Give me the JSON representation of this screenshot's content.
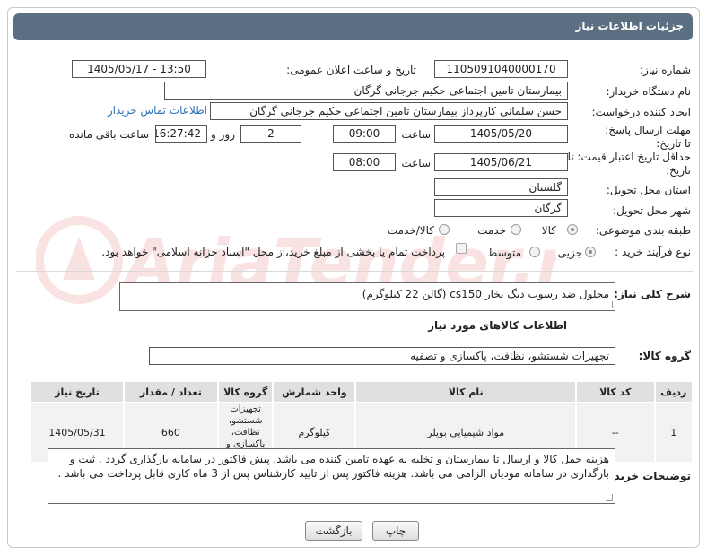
{
  "header": {
    "title": "جزئیات اطلاعات نیاز"
  },
  "fields": {
    "need_number_label": "شماره نیاز:",
    "need_number": "1105091040000170",
    "announce_label": "تاریخ و ساعت اعلان عمومی:",
    "announce_value": "1405/05/17 - 13:50",
    "buyer_org_label": "نام دستگاه خریدار:",
    "buyer_org": "بیمارستان تامین اجتماعی حکیم جرجانی گرگان",
    "creator_label": "ایجاد کننده درخواست:",
    "creator": "حسن سلمانی کارپرداز بیمارستان تامین اجتماعی حکیم جرجانی گرگان",
    "buyer_contact_link": "اطلاعات تماس خریدار",
    "deadline_label": "مهلت ارسال پاسخ: تا تاریخ:",
    "deadline_date": "1405/05/20",
    "time_label": "ساعت",
    "deadline_time": "09:00",
    "days_value": "2",
    "days_label": "روز و",
    "remaining_time": "16:27:42",
    "remaining_label": "ساعت باقی مانده",
    "price_validity_label": "حداقل تاریخ اعتبار قیمت: تا تاریخ:",
    "price_validity_date": "1405/06/21",
    "price_validity_time": "08:00",
    "province_label": "استان محل تحویل:",
    "province": "گلستان",
    "city_label": "شهر محل تحویل:",
    "city": "گرگان",
    "category_label": "طبقه بندی موضوعی:",
    "category_options": [
      "کالا",
      "خدمت",
      "کالا/خدمت"
    ],
    "process_label": "نوع فرآیند خرید :",
    "process_options": [
      "جزیی",
      "متوسط"
    ],
    "payment_note": "پرداخت تمام یا بخشی از مبلغ خرید،از محل \"اسناد خزانه اسلامی\" خواهد بود.",
    "summary_label": "شرح کلی نیاز:",
    "summary": "محلول ضد رسوب دیگ بخار cs150 (گالن 22 کیلوگرم)",
    "goods_info_title": "اطلاعات کالاهای مورد نیاز",
    "goods_group_label": "گروه کالا:",
    "goods_group": "تجهیزات شستشو، نظافت، پاکسازی و تصفیه"
  },
  "table": {
    "headers": [
      "ردیف",
      "کد کالا",
      "نام کالا",
      "واحد شمارش",
      "گروه کالا",
      "تعداد / مقدار",
      "تاریخ نیاز"
    ],
    "rows": [
      [
        "1",
        "--",
        "مواد شیمیایی بویلر",
        "کیلوگرم",
        "تجهیزات شستشو، نظافت، پاکسازی و تصفیه",
        "660",
        "1405/05/31"
      ]
    ]
  },
  "notes": {
    "label": "توضیحات خریدار:",
    "text": "هزینه حمل کالا و ارسال تا بیمارستان و تخلیه به عهده تامین کننده می باشد. پیش فاکتور در سامانه بارگذاری گردد . ثبت و بارگذاری در سامانه مودیان الزامی می باشد. هزینه فاکتور پس از تایید کارشناس پس از 3 ماه کاری قابل پرداخت می باشد ."
  },
  "buttons": {
    "print": "چاپ",
    "back": "بازگشت"
  },
  "watermark": {
    "text": "AriaTender.net"
  },
  "colors": {
    "header_bg": "#5b6e82",
    "link": "#2a72b8",
    "watermark": "#d9534f"
  }
}
